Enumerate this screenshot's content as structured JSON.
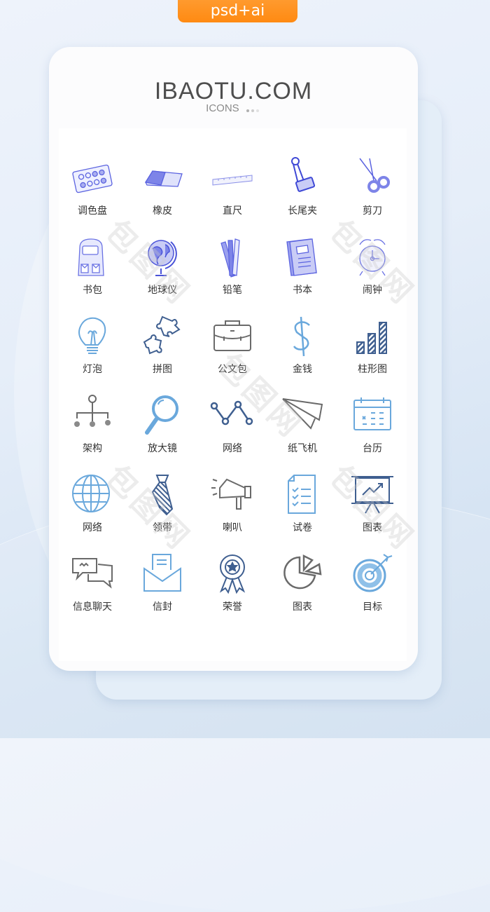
{
  "badge": {
    "label": "psd+ai"
  },
  "header": {
    "title": "IBAOTU.COM",
    "subtitle": "ICONS"
  },
  "colors": {
    "badge": "#ff8a12",
    "purple": "#5b63e0",
    "blue": "#6aa8dc",
    "navy": "#3f5f90",
    "gray": "#6a6a6a"
  },
  "icons": [
    {
      "icon": "palette-icon",
      "label": "调色盘"
    },
    {
      "icon": "eraser-icon",
      "label": "橡皮"
    },
    {
      "icon": "ruler-icon",
      "label": "直尺"
    },
    {
      "icon": "binder-clip-icon",
      "label": "长尾夹"
    },
    {
      "icon": "scissors-icon",
      "label": "剪刀"
    },
    {
      "icon": "backpack-icon",
      "label": "书包"
    },
    {
      "icon": "globe-icon",
      "label": "地球仪"
    },
    {
      "icon": "pencils-icon",
      "label": "铅笔"
    },
    {
      "icon": "book-icon",
      "label": "书本"
    },
    {
      "icon": "alarm-clock-icon",
      "label": "闹钟"
    },
    {
      "icon": "lightbulb-icon",
      "label": "灯泡"
    },
    {
      "icon": "puzzle-icon",
      "label": "拼图"
    },
    {
      "icon": "briefcase-icon",
      "label": "公文包"
    },
    {
      "icon": "dollar-icon",
      "label": "金钱"
    },
    {
      "icon": "bar-chart-icon",
      "label": "柱形图"
    },
    {
      "icon": "org-chart-icon",
      "label": "架构"
    },
    {
      "icon": "magnifier-icon",
      "label": "放大镜"
    },
    {
      "icon": "network-line-icon",
      "label": "网络"
    },
    {
      "icon": "paper-plane-icon",
      "label": "纸飞机"
    },
    {
      "icon": "calendar-icon",
      "label": "台历"
    },
    {
      "icon": "world-icon",
      "label": "网络"
    },
    {
      "icon": "tie-icon",
      "label": "领带"
    },
    {
      "icon": "megaphone-icon",
      "label": "喇叭"
    },
    {
      "icon": "checklist-icon",
      "label": "试卷"
    },
    {
      "icon": "presentation-chart-icon",
      "label": "图表"
    },
    {
      "icon": "chat-bubbles-icon",
      "label": "信息聊天"
    },
    {
      "icon": "envelope-icon",
      "label": "信封"
    },
    {
      "icon": "award-ribbon-icon",
      "label": "荣誉"
    },
    {
      "icon": "pie-chart-icon",
      "label": "图表"
    },
    {
      "icon": "target-icon",
      "label": "目标"
    }
  ],
  "watermark": "包图网"
}
